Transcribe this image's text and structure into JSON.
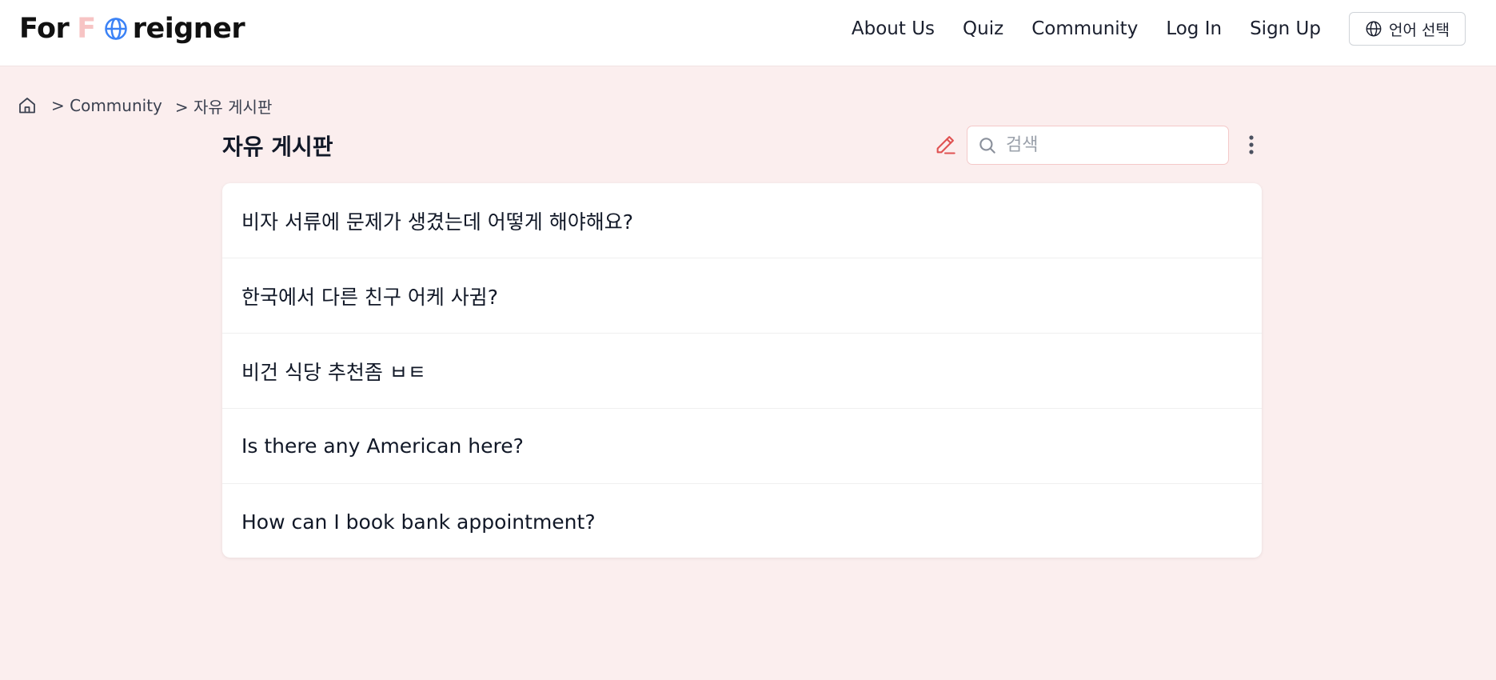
{
  "header": {
    "logo": {
      "part1": "For",
      "part2": "F",
      "part3": "reigner",
      "icon": "globe-icon"
    },
    "nav": {
      "about": "About Us",
      "quiz": "Quiz",
      "community": "Community",
      "login": "Log In",
      "signup": "Sign Up"
    },
    "language_button": {
      "label": "언어 선택",
      "icon": "globe-icon"
    }
  },
  "breadcrumb": {
    "home_icon": "home-icon",
    "items": [
      "> Community",
      "> 자유 게시판"
    ]
  },
  "board": {
    "title": "자유 게시판",
    "write_icon": "pencil-icon",
    "search_placeholder": "검색",
    "search_icon": "search-icon",
    "more_icon": "more-vertical-icon"
  },
  "posts": [
    {
      "title": "비자 서류에 문제가 생겼는데 어떻게 해야해요?"
    },
    {
      "title": "한국에서 다른 친구 어케 사귐?"
    },
    {
      "title": "비건 식당 추천좀 ㅂㅌ"
    },
    {
      "title": "Is there any American here?"
    },
    {
      "title": "How can I book bank appointment?"
    }
  ],
  "colors": {
    "background": "#fbeeee",
    "accent_pink": "#f7c4c4",
    "logo_globe": "#3b82f6",
    "pencil": "#e05252"
  }
}
